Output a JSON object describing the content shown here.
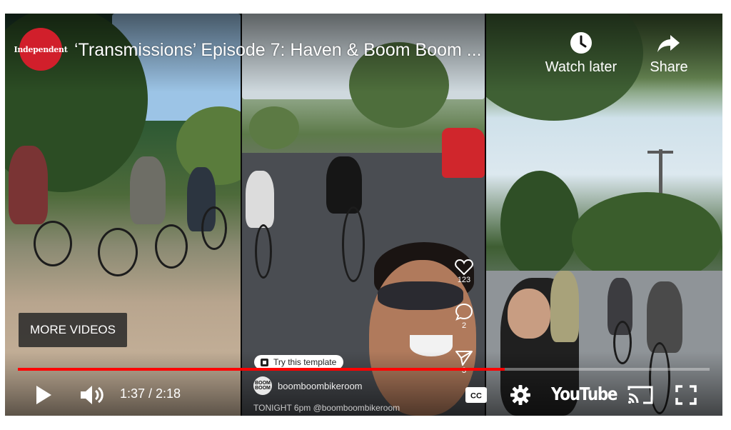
{
  "player": {
    "channel_logo_text": "Independent",
    "title": "‘Transmissions’ Episode 7: Haven & Boom Boom ...",
    "top_actions": [
      {
        "label": "Watch later",
        "icon": "clock-icon"
      },
      {
        "label": "Share",
        "icon": "share-arrow-icon"
      }
    ],
    "more_videos_label": "MORE VIDEOS",
    "progress": {
      "fraction": 0.704,
      "current": "1:37",
      "duration": "2:18"
    },
    "time_display": "1:37 / 2:18",
    "youtube_logo": "YouTube",
    "controls": [
      "play-icon",
      "volume-icon",
      "captions-icon",
      "settings-gear-icon",
      "youtube-logo",
      "cast-icon",
      "fullscreen-icon"
    ],
    "cc_label": "CC"
  },
  "embedded_reel": {
    "likes": "123",
    "comments": "2",
    "shares": "3",
    "template_label": "Try this template",
    "handle": "boomboombikeroom",
    "avatar_text": "BOOM BOOM",
    "caption": "TONIGHT 6pm @boomboombikeroom"
  },
  "colors": {
    "accent": "#ff0000",
    "logo_red": "#d11f2b"
  }
}
